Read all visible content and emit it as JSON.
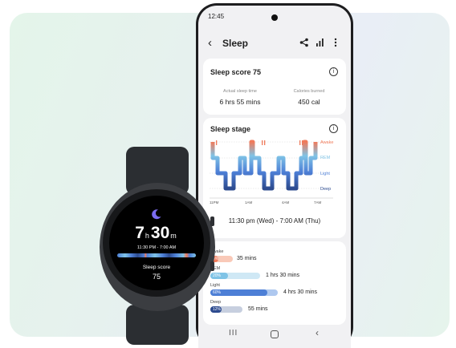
{
  "phone": {
    "status_time": "12:45",
    "appbar": {
      "title": "Sleep",
      "icons": [
        "back-icon",
        "share-icon",
        "stats-icon",
        "more-icon"
      ]
    },
    "score_card": {
      "title": "Sleep score 75",
      "actual_label": "Actual sleep time",
      "actual_value": "6 hrs 55 mins",
      "calories_label": "Calories burned",
      "calories_value": "450 cal"
    },
    "stage_card": {
      "title": "Sleep stage",
      "stage_labels": [
        "Awake",
        "REM",
        "Light",
        "Deep"
      ],
      "time_ticks": [
        "11PM",
        "1AM",
        "4AM",
        "7AM"
      ],
      "time_range": "11:30 pm (Wed) - 7:00 AM (Thu)"
    },
    "stages": [
      {
        "name": "Awake",
        "percent": "5%",
        "fraction": 0.05,
        "duration": "35 mins",
        "color": "#f07a5a",
        "track": "#f9c9b8"
      },
      {
        "name": "REM",
        "percent": "20%",
        "fraction": 0.2,
        "duration": "1 hrs 30 mins",
        "color": "#7fc3e6",
        "track": "#cfe8f5"
      },
      {
        "name": "Light",
        "percent": "60%",
        "fraction": 0.6,
        "duration": "4 hrs 30 mins",
        "color": "#4d7fd6",
        "track": "#aec8ef"
      },
      {
        "name": "Deep",
        "percent": "12%",
        "fraction": 0.12,
        "duration": "55 mins",
        "color": "#2d4b8f",
        "track": "#c7cfdf"
      }
    ],
    "navbar": {
      "recent": "III",
      "back": "‹"
    }
  },
  "watch": {
    "hours": "7",
    "hours_unit": "h",
    "minutes": "30",
    "minutes_unit": "m",
    "range": "11:30 PM - 7:00 AM",
    "score_label": "Sleep score",
    "score": "75",
    "icon": "moon-icon"
  },
  "colors": {
    "awake": "#f07a5a",
    "rem": "#7fc3e6",
    "light": "#4d7fd6",
    "deep": "#2d4b8f"
  }
}
